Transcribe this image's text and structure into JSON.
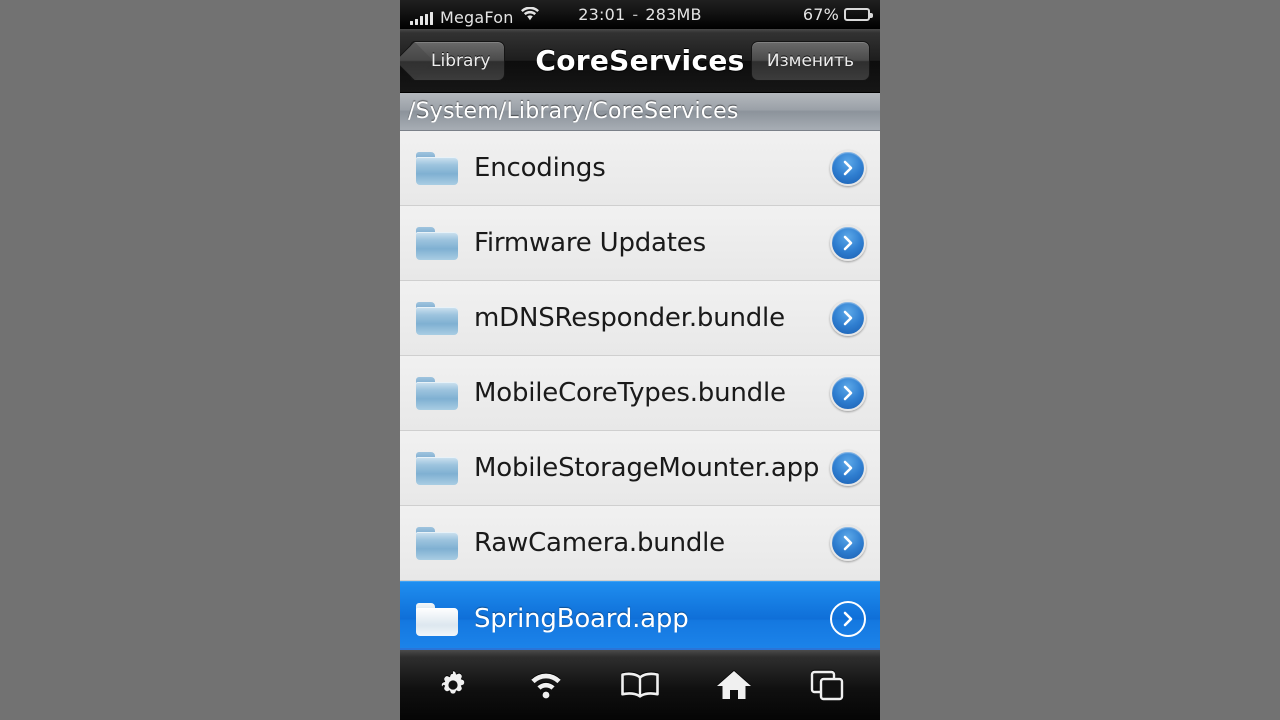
{
  "statusbar": {
    "carrier": "MegaFon",
    "signal_icon": "signal-bars-icon",
    "wifi_icon": "wifi-icon",
    "time": "23:01",
    "separator": "-",
    "memory": "283MB",
    "battery_percent": "67%",
    "battery_icon": "battery-icon",
    "battery_level": 67
  },
  "navbar": {
    "back_label": "Library",
    "title": "CoreServices",
    "edit_label": "Изменить"
  },
  "pathbar": {
    "path": "/System/Library/CoreServices"
  },
  "list": {
    "rows": [
      {
        "label": "Encodings",
        "icon": "folder-icon",
        "accessory": "disclosure-chevron-icon",
        "selected": false
      },
      {
        "label": "Firmware Updates",
        "icon": "folder-icon",
        "accessory": "disclosure-chevron-icon",
        "selected": false
      },
      {
        "label": "mDNSResponder.bundle",
        "icon": "folder-icon",
        "accessory": "disclosure-chevron-icon",
        "selected": false
      },
      {
        "label": "MobileCoreTypes.bundle",
        "icon": "folder-icon",
        "accessory": "disclosure-chevron-icon",
        "selected": false
      },
      {
        "label": "MobileStorageMounter.app",
        "icon": "folder-icon",
        "accessory": "disclosure-chevron-icon",
        "selected": false
      },
      {
        "label": "RawCamera.bundle",
        "icon": "folder-icon",
        "accessory": "disclosure-chevron-icon",
        "selected": false
      },
      {
        "label": "SpringBoard.app",
        "icon": "folder-icon",
        "accessory": "disclosure-chevron-icon",
        "selected": true
      }
    ]
  },
  "toolbar": {
    "items": [
      {
        "icon": "gear-icon"
      },
      {
        "icon": "wifi-icon"
      },
      {
        "icon": "book-icon"
      },
      {
        "icon": "home-icon"
      },
      {
        "icon": "windows-copy-icon"
      }
    ]
  },
  "colors": {
    "backdrop": "#727272",
    "selection_blue": "#1478e0",
    "toolbar_accent": "#2a74d8",
    "list_background": "#ececec",
    "navbar_dark": "#1d1d1d"
  }
}
